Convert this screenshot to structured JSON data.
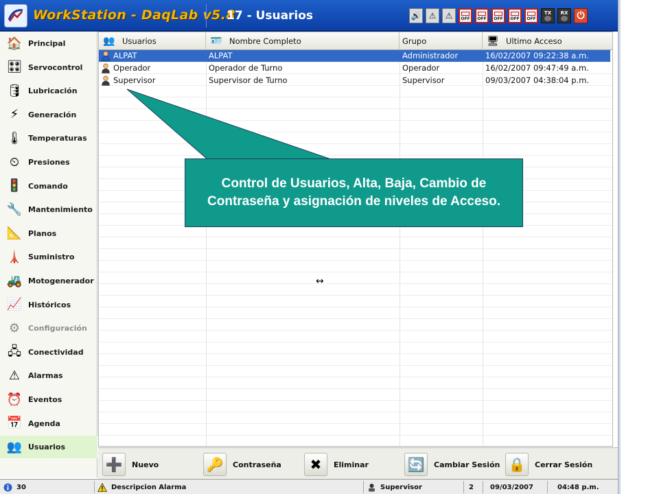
{
  "app": {
    "title": "WorkStation - DaqLab v5.8",
    "screen_title": "17 - Usuarios"
  },
  "toolbar": {
    "buttons": [
      {
        "name": "speaker-icon",
        "glyph": "🔊",
        "kind": "normal"
      },
      {
        "name": "warning-outline-icon",
        "glyph": "⚠",
        "kind": "normal"
      },
      {
        "name": "warning-outline-2-icon",
        "glyph": "⚠",
        "kind": "normal"
      },
      {
        "name": "relay-off-1-icon",
        "label": "OFF",
        "kind": "off"
      },
      {
        "name": "relay-off-2-icon",
        "label": "OFF",
        "kind": "off"
      },
      {
        "name": "relay-off-3-icon",
        "label": "OFF",
        "kind": "off"
      },
      {
        "name": "relay-off-4-icon",
        "label": "OFF",
        "kind": "off"
      },
      {
        "name": "relay-off-5-icon",
        "label": "OFF",
        "kind": "off"
      },
      {
        "name": "tx-icon",
        "label": "TX",
        "kind": "txrx"
      },
      {
        "name": "rx-icon",
        "label": "RX",
        "kind": "txrx"
      },
      {
        "name": "power-icon",
        "glyph": "⏻",
        "kind": "power"
      }
    ]
  },
  "sidebar": {
    "items": [
      {
        "label": "Principal",
        "icon": "home-icon",
        "glyph": "🏠",
        "active": false,
        "disabled": false
      },
      {
        "label": "Servocontrol",
        "icon": "servocontrol-icon",
        "glyph": "🎛",
        "active": false,
        "disabled": false
      },
      {
        "label": "Lubricación",
        "icon": "oil-can-icon",
        "glyph": "🛢",
        "active": false,
        "disabled": false
      },
      {
        "label": "Generación",
        "icon": "lightning-icon",
        "glyph": "⚡",
        "active": false,
        "disabled": false
      },
      {
        "label": "Temperaturas",
        "icon": "thermometer-icon",
        "glyph": "🌡",
        "active": false,
        "disabled": false
      },
      {
        "label": "Presiones",
        "icon": "pressure-gauge-icon",
        "glyph": "⏲",
        "active": false,
        "disabled": false
      },
      {
        "label": "Comando",
        "icon": "traffic-light-icon",
        "glyph": "🚦",
        "active": false,
        "disabled": false
      },
      {
        "label": "Mantenimiento",
        "icon": "tools-icon",
        "glyph": "🔧",
        "active": false,
        "disabled": false
      },
      {
        "label": "Planos",
        "icon": "blueprint-icon",
        "glyph": "📐",
        "active": false,
        "disabled": false
      },
      {
        "label": "Suministro",
        "icon": "power-tower-icon",
        "glyph": "🗼",
        "active": false,
        "disabled": false
      },
      {
        "label": "Motogenerador",
        "icon": "generator-icon",
        "glyph": "🚜",
        "active": false,
        "disabled": false
      },
      {
        "label": "Históricos",
        "icon": "chart-icon",
        "glyph": "📈",
        "active": false,
        "disabled": false
      },
      {
        "label": "Configuración",
        "icon": "gears-icon",
        "glyph": "⚙",
        "active": false,
        "disabled": true
      },
      {
        "label": "Conectividad",
        "icon": "network-icon",
        "glyph": "🖧",
        "active": false,
        "disabled": false
      },
      {
        "label": "Alarmas",
        "icon": "alarm-triangle-icon",
        "glyph": "⚠",
        "active": false,
        "disabled": false
      },
      {
        "label": "Eventos",
        "icon": "clock-icon",
        "glyph": "⏰",
        "active": false,
        "disabled": false
      },
      {
        "label": "Agenda",
        "icon": "calendar-icon",
        "glyph": "📅",
        "active": false,
        "disabled": false
      },
      {
        "label": "Usuarios",
        "icon": "users-icon",
        "glyph": "👥",
        "active": true,
        "disabled": false
      }
    ]
  },
  "table": {
    "columns": [
      {
        "label": "Usuarios",
        "icon": "users-icon",
        "glyph": "👥"
      },
      {
        "label": "Nombre Completo",
        "icon": "id-badge-icon",
        "glyph": "🪪"
      },
      {
        "label": "Grupo",
        "icon": "",
        "glyph": ""
      },
      {
        "label": "Ultimo Acceso",
        "icon": "login-icon",
        "glyph": "🖥"
      }
    ],
    "rows": [
      {
        "user": "ALPAT",
        "full_name": "ALPAT",
        "group": "Administrador",
        "last_access": "16/02/2007 09:22:38 a.m.",
        "selected": true
      },
      {
        "user": "Operador",
        "full_name": "Operador de Turno",
        "group": "Operador",
        "last_access": "16/02/2007 09:47:49 a.m.",
        "selected": false
      },
      {
        "user": "Supervisor",
        "full_name": "Supervisor de Turno",
        "group": "Supervisor",
        "last_access": "09/03/2007 04:38:04 p.m.",
        "selected": false
      }
    ]
  },
  "callout": {
    "text": "Control de Usuarios, Alta, Baja, Cambio de Contraseña y asignación de niveles de Acceso."
  },
  "actions": [
    {
      "label": "Nuevo",
      "icon": "add-user-icon",
      "glyph": "➕"
    },
    {
      "label": "Contraseña",
      "icon": "password-icon",
      "glyph": "🔑"
    },
    {
      "label": "Eliminar",
      "icon": "delete-user-icon",
      "glyph": "✖"
    },
    {
      "label": "Cambiar Sesión",
      "icon": "switch-session-icon",
      "glyph": "🔄"
    },
    {
      "label": "Cerrar Sesión",
      "icon": "lock-icon",
      "glyph": "🔒"
    }
  ],
  "statusbar": {
    "count": "30",
    "alarm_label": "Descripcion Alarma",
    "user": "Supervisor",
    "level": "2",
    "date": "09/03/2007",
    "time": "04:48 p.m."
  },
  "colors": {
    "titlebar": "#0b3fa6",
    "app_title": "#f7b500",
    "selected_row": "#3169c6",
    "callout": "#0f9a8c",
    "active_sidebar": "#dff4cf"
  }
}
